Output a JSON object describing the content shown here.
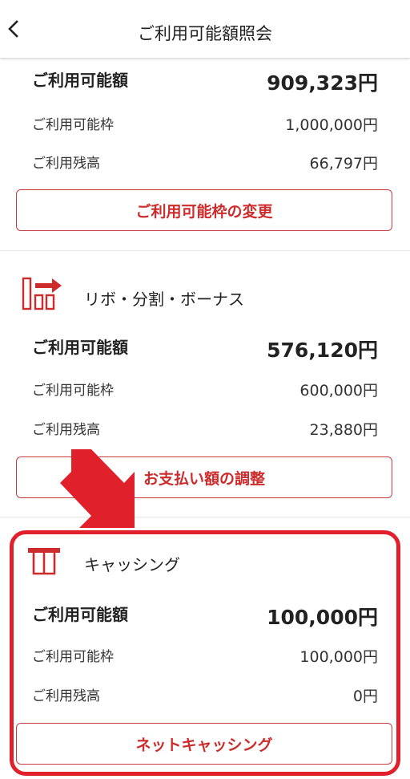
{
  "header": {
    "title": "ご利用可能額照会",
    "back_icon": "chevron-left-icon"
  },
  "shopping": {
    "available_label": "ご利用可能額",
    "available_value": "909,323円",
    "limit_label": "ご利用可能枠",
    "limit_value": "1,000,000円",
    "balance_label": "ご利用残高",
    "balance_value": "66,797円",
    "button_label": "ご利用可能枠の変更"
  },
  "revolving": {
    "title": "リボ・分割・ボーナス",
    "icon": "revolving-split-icon",
    "available_label": "ご利用可能額",
    "available_value": "576,120円",
    "limit_label": "ご利用可能枠",
    "limit_value": "600,000円",
    "balance_label": "ご利用残高",
    "balance_value": "23,880円",
    "button_label": "お支払い額の調整"
  },
  "cashing": {
    "title": "キャッシング",
    "icon": "atm-cash-icon",
    "available_label": "ご利用可能額",
    "available_value": "100,000円",
    "limit_label": "ご利用可能枠",
    "limit_value": "100,000円",
    "balance_label": "ご利用残高",
    "balance_value": "0円",
    "button_label": "ネットキャッシング"
  },
  "colors": {
    "accent": "#cc2c2c",
    "highlight": "#e0202a"
  }
}
